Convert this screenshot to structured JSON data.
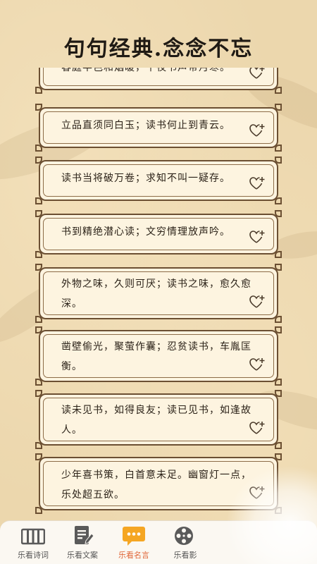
{
  "header": {
    "title": "句句经典.念念不忘"
  },
  "quotes": [
    "春庭半色和烟暖，午夜书声带月寒。",
    "立品直须同白玉；读书何止到青云。",
    "读书当将破万卷；求知不叫一疑存。",
    "书到精绝潜心读；文穷情理放声吟。",
    "外物之味，久则可厌；读书之味，愈久愈深。",
    "凿壁偷光，聚萤作囊；忍贫读书，车胤匡衡。",
    "读未见书，如得良友；读已见书，如逢故人。",
    "少年喜书策，白首意未足。幽窗灯一点，乐处超五欲。"
  ],
  "tabs": [
    {
      "label": "乐看诗词",
      "icon": "book-icon"
    },
    {
      "label": "乐看文案",
      "icon": "notepad-icon"
    },
    {
      "label": "乐看名言",
      "icon": "chat-bubble-icon"
    },
    {
      "label": "乐看影",
      "icon": "film-reel-icon"
    }
  ],
  "colors": {
    "accent": "#f5a623",
    "active_label": "#e0673a",
    "card_border": "#6b4f32",
    "card_bg": "#fdf4e0"
  }
}
